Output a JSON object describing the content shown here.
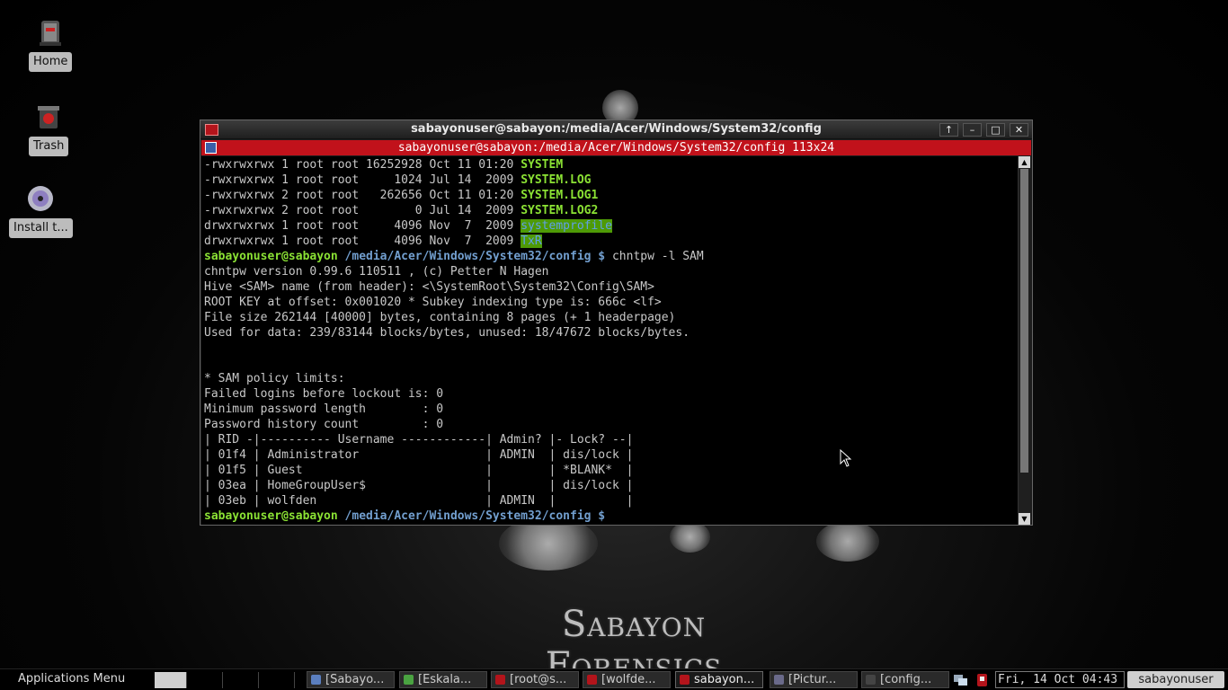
{
  "desktop": {
    "icons": [
      {
        "label": "Home",
        "icon": "home-icon"
      },
      {
        "label": "Trash",
        "icon": "trash-icon"
      },
      {
        "label": "Install t...",
        "icon": "installer-disc-icon"
      }
    ],
    "wallpaper_text": "Sabayon Forensics"
  },
  "window": {
    "title": "sabayonuser@sabayon:/media/Acer/Windows/System32/config",
    "controls": [
      "↑",
      "–",
      "□",
      "✕"
    ],
    "terminal_header": "sabayonuser@sabayon:/media/Acer/Windows/System32/config 113x24"
  },
  "terminal": {
    "listing": [
      {
        "meta": "-rwxrwxrwx 1 root root 16252928 Oct 11 01:20 ",
        "name": "SYSTEM",
        "style": "file"
      },
      {
        "meta": "-rwxrwxrwx 1 root root     1024 Jul 14  2009 ",
        "name": "SYSTEM.LOG",
        "style": "file"
      },
      {
        "meta": "-rwxrwxrwx 2 root root   262656 Oct 11 01:20 ",
        "name": "SYSTEM.LOG1",
        "style": "file"
      },
      {
        "meta": "-rwxrwxrwx 2 root root        0 Jul 14  2009 ",
        "name": "SYSTEM.LOG2",
        "style": "file"
      },
      {
        "meta": "drwxrwxrwx 1 root root     4096 Nov  7  2009 ",
        "name": "systemprofile",
        "style": "dir"
      },
      {
        "meta": "drwxrwxrwx 1 root root     4096 Nov  7  2009 ",
        "name": "TxR",
        "style": "dir"
      }
    ],
    "prompt_user": "sabayonuser@sabayon",
    "prompt_path": " /media/Acer/Windows/System32/config $",
    "command": " chntpw -l SAM",
    "output": [
      "chntpw version 0.99.6 110511 , (c) Petter N Hagen",
      "Hive <SAM> name (from header): <\\SystemRoot\\System32\\Config\\SAM>",
      "ROOT KEY at offset: 0x001020 * Subkey indexing type is: 666c <lf>",
      "File size 262144 [40000] bytes, containing 8 pages (+ 1 headerpage)",
      "Used for data: 239/83144 blocks/bytes, unused: 18/47672 blocks/bytes.",
      "",
      "",
      "* SAM policy limits:",
      "Failed logins before lockout is: 0",
      "Minimum password length        : 0",
      "Password history count         : 0",
      "| RID -|---------- Username ------------| Admin? |- Lock? --|",
      "| 01f4 | Administrator                  | ADMIN  | dis/lock |",
      "| 01f5 | Guest                          |        | *BLANK*  |",
      "| 03ea | HomeGroupUser$                 |        | dis/lock |",
      "| 03eb | wolfden                        | ADMIN  |          |"
    ]
  },
  "taskbar": {
    "apps_menu": "Applications Menu",
    "tasks": [
      {
        "label": "[Sabayo...",
        "color": "#5b7fbf"
      },
      {
        "label": "[Eskala...",
        "color": "#4aa341"
      },
      {
        "label": "[root@s...",
        "color": "#b3141b"
      },
      {
        "label": "[wolfde...",
        "color": "#b3141b"
      },
      {
        "label": "sabayon...",
        "color": "#b3141b",
        "active": true
      },
      {
        "label": "[Pictur...",
        "color": "#6a6a8a"
      },
      {
        "label": "[config...",
        "color": "#444444"
      }
    ],
    "clock": "Fri, 14 Oct  04:43",
    "user": "sabayonuser"
  }
}
